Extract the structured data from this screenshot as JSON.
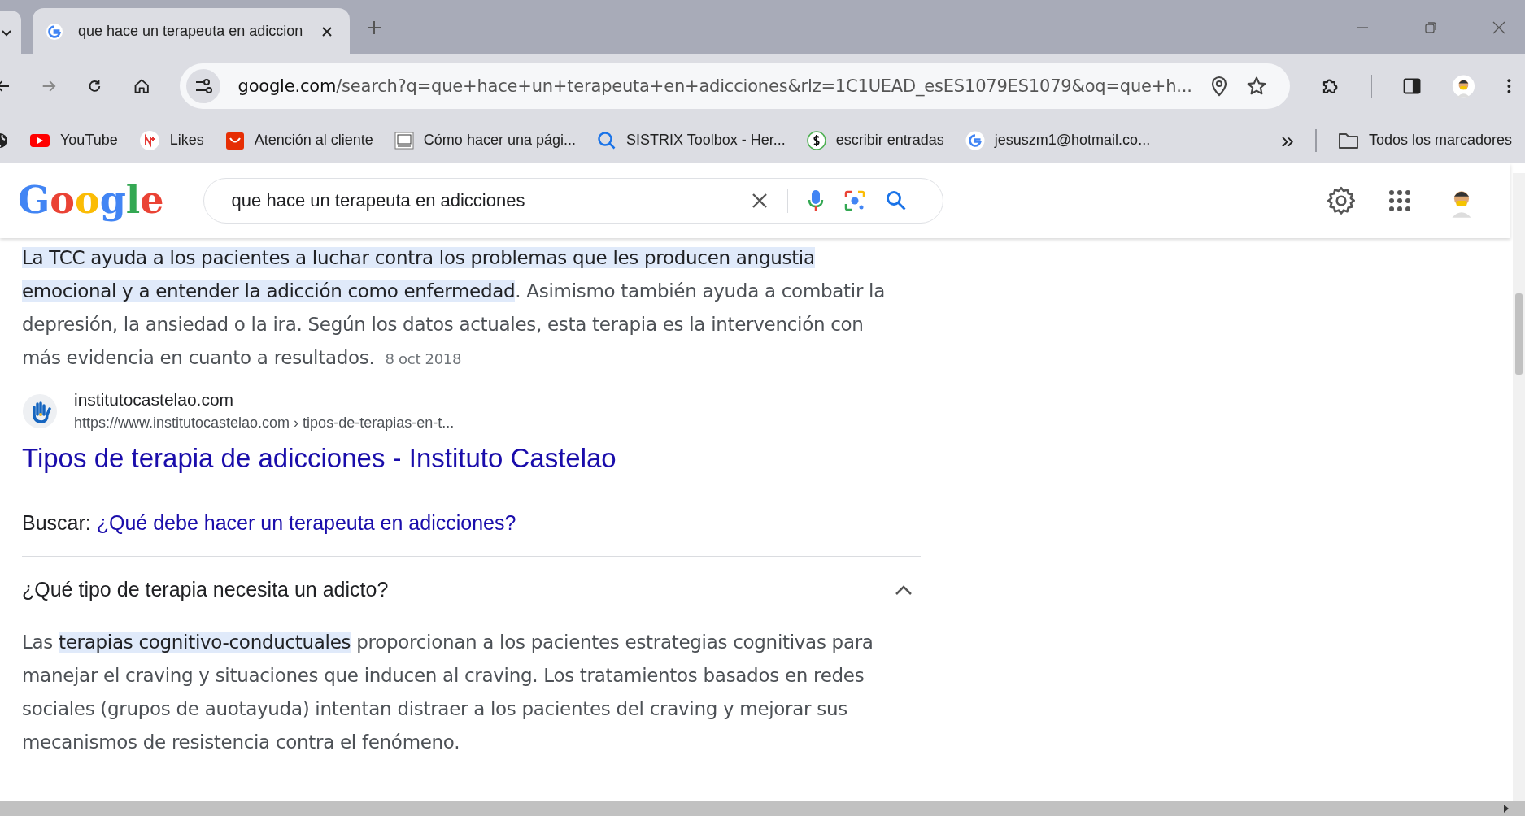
{
  "browser": {
    "tab": {
      "title": "que hace un terapeuta en adiccion",
      "selected": true
    },
    "address": {
      "host": "google.com",
      "path": "/search?q=que+hace+un+terapeuta+en+adicciones&rlz=1C1UEAD_esES1079ES1079&oq=que+h..."
    },
    "bookmarks": [
      {
        "label": "YouTube",
        "kind": "youtube"
      },
      {
        "label": "Likes",
        "kind": "likes"
      },
      {
        "label": "Atención al cliente",
        "kind": "bag"
      },
      {
        "label": "Cómo hacer una pági...",
        "kind": "screen"
      },
      {
        "label": "SISTRIX Toolbox - Her...",
        "kind": "search"
      },
      {
        "label": "escribir entradas",
        "kind": "dollar"
      },
      {
        "label": "jesuszm1@hotmail.co...",
        "kind": "google"
      }
    ],
    "overflow": "»",
    "all_bookmarks": "Todos los marcadores"
  },
  "header": {
    "logo": "Google",
    "query": "que hace un terapeuta en adicciones"
  },
  "snippet": {
    "segments": [
      {
        "text": "La TCC ayuda a los pacientes a luchar contra los problemas que les producen angustia emocional y a entender la adicción como enfermedad",
        "highlighted": true
      },
      {
        "text": ". Asimismo también ayuda a combatir la depresión, la ansiedad o la ira. Según los datos actuales, esta terapia es la intervención con más evidencia en cuanto a resultados.",
        "highlighted": false
      }
    ],
    "date": "8 oct 2018"
  },
  "result": {
    "site": "institutocastelao.com",
    "url": "https://www.institutocastelao.com › tipos-de-terapias-en-t...",
    "title": "Tipos de terapia de adicciones - Instituto Castelao"
  },
  "search_more": {
    "label": "Buscar:",
    "link": "¿Qué debe hacer un terapeuta en adicciones?"
  },
  "question": {
    "title": "¿Qué tipo de terapia necesita un adicto?",
    "expanded": true,
    "segments": [
      {
        "text": "Las ",
        "highlighted": false
      },
      {
        "text": "terapias cognitivo-conductuales",
        "highlighted": true
      },
      {
        "text": " proporcionan a los pacientes estrategias cognitivas para manejar el craving y situaciones que inducen al craving. Los tratamientos basados en redes sociales (grupos de auotayuda) intentan distraer a los pacientes del craving y mejorar sus mecanismos de resistencia contra el fenómeno.",
        "highlighted": false
      }
    ]
  }
}
